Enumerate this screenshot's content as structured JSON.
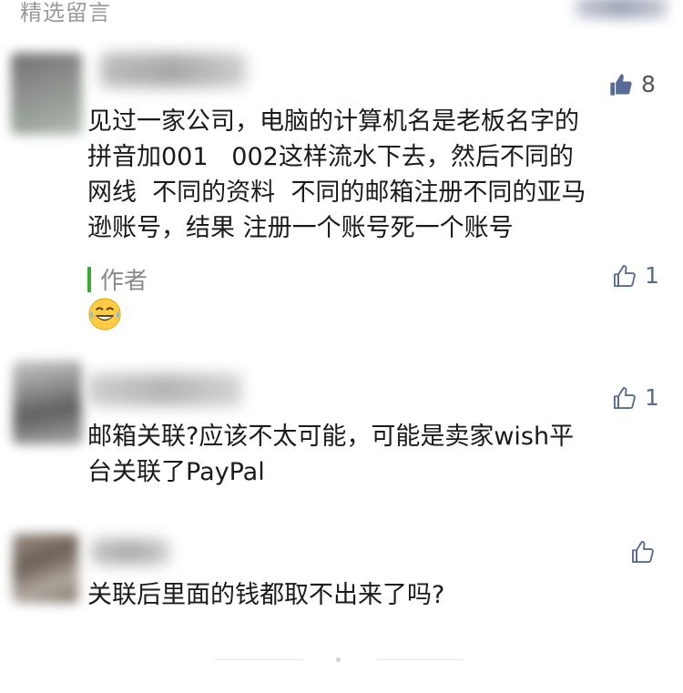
{
  "section": {
    "title": "精选留言"
  },
  "comments": [
    {
      "likes": "8",
      "text": "见过一家公司，电脑的计算机名是老板名字的\n拼音加001   002这样流水下去，然后不同的\n网线  不同的资料  不同的邮箱注册不同的亚马\n逊账号，结果 注册一个账号死一个账号",
      "reply": {
        "label": "作者",
        "likes": "1",
        "emoji_icon": "laughing-tears-emoji"
      }
    },
    {
      "likes": "1",
      "text": "邮箱关联?应该不太可能，可能是卖家wish平\n台关联了PayPal"
    },
    {
      "likes": "",
      "text": "关联后里面的钱都取不出来了吗?"
    }
  ],
  "colors": {
    "link": "#576b95",
    "author_bar": "#3aaa35",
    "muted": "#9a9a9a"
  }
}
